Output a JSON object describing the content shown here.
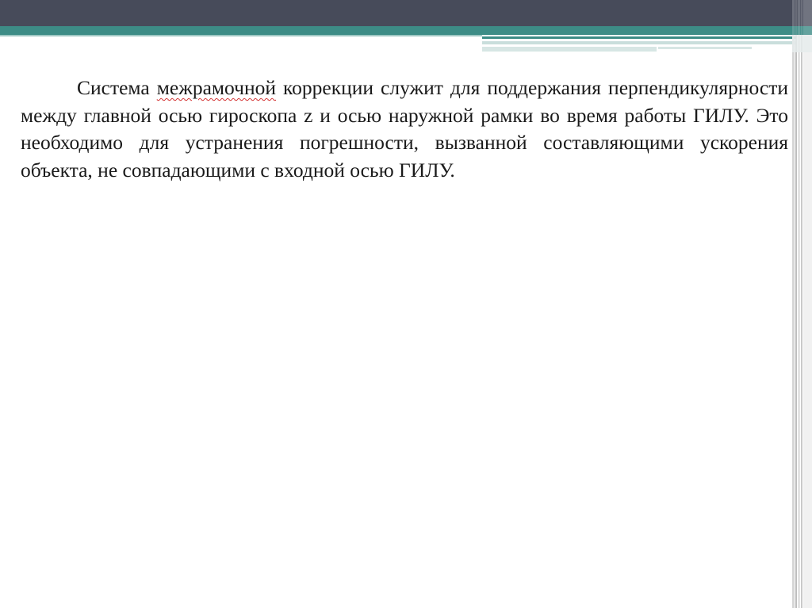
{
  "document": {
    "paragraph": {
      "part1": "Система ",
      "misspelled_word": "межрамочной",
      "part2": " коррекции служит для поддержания перпендикулярности между главной осью гироскопа z и осью наружной рамки во время работы ГИЛУ. Это необходимо для устранения погрешности, вызванной составляющими ускорения объекта, не совпадающими с входной осью ГИЛУ."
    }
  },
  "colors": {
    "header_dark": "#474b5a",
    "header_teal": "#3d8c86",
    "spellcheck_underline": "#d23030",
    "text": "#1a1a1a"
  }
}
